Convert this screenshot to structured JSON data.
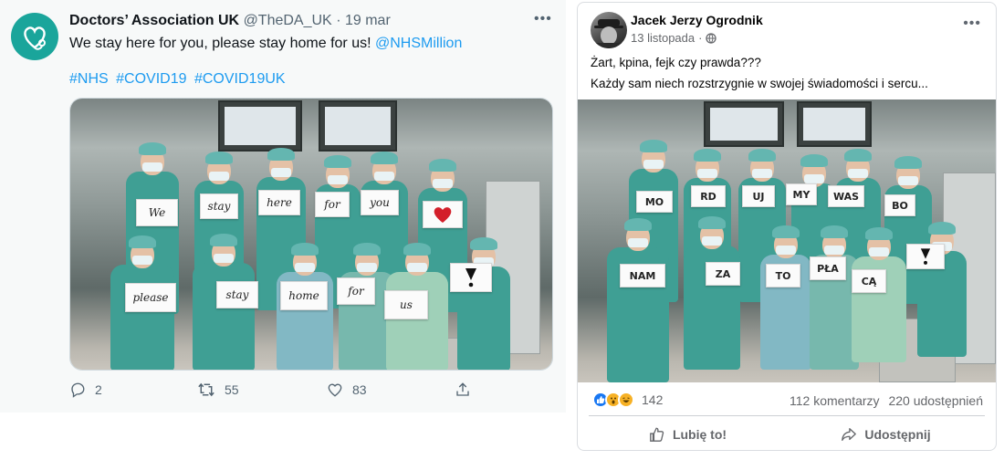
{
  "tweet": {
    "name": "Doctors’ Association UK",
    "handle": "@TheDA_UK",
    "separator": "·",
    "date": "19 mar",
    "more": "•••",
    "text": "We stay here for you, please stay home for us! ",
    "mention": "@NHSMillion",
    "hashtags": [
      "#NHS",
      "#COVID19",
      "#COVID19UK"
    ],
    "sign_words": [
      "We",
      "stay",
      "here",
      "for",
      "you",
      "please",
      "stay",
      "home",
      "for",
      "us"
    ],
    "stats": {
      "replies": "2",
      "retweets": "55",
      "likes": "83"
    },
    "colors": {
      "accent": "#1d9bf0",
      "muted": "#536471",
      "avatar_bg": "#1aa59b"
    }
  },
  "facebook": {
    "name": "Jacek Jerzy Ogrodnik",
    "date": "13 listopada",
    "separator": "·",
    "more": "•••",
    "line1": "Żart, kpina, fejk czy prawda???",
    "line2": "Każdy sam niech rozstrzygnie w swojej świadomości i sercu...",
    "sign_words": [
      "MO",
      "RD",
      "UJ",
      "MY",
      "WAS",
      "BO",
      "NAM",
      "ZA",
      "TO",
      "PŁA",
      "CĄ"
    ],
    "reactions_count": "142",
    "comments": "112 komentarzy",
    "shares": "220 udostępnień",
    "like_label": "Lubię to!",
    "share_label": "Udostępnij",
    "colors": {
      "like_blue": "#1877f2",
      "muted": "#65676b"
    }
  }
}
